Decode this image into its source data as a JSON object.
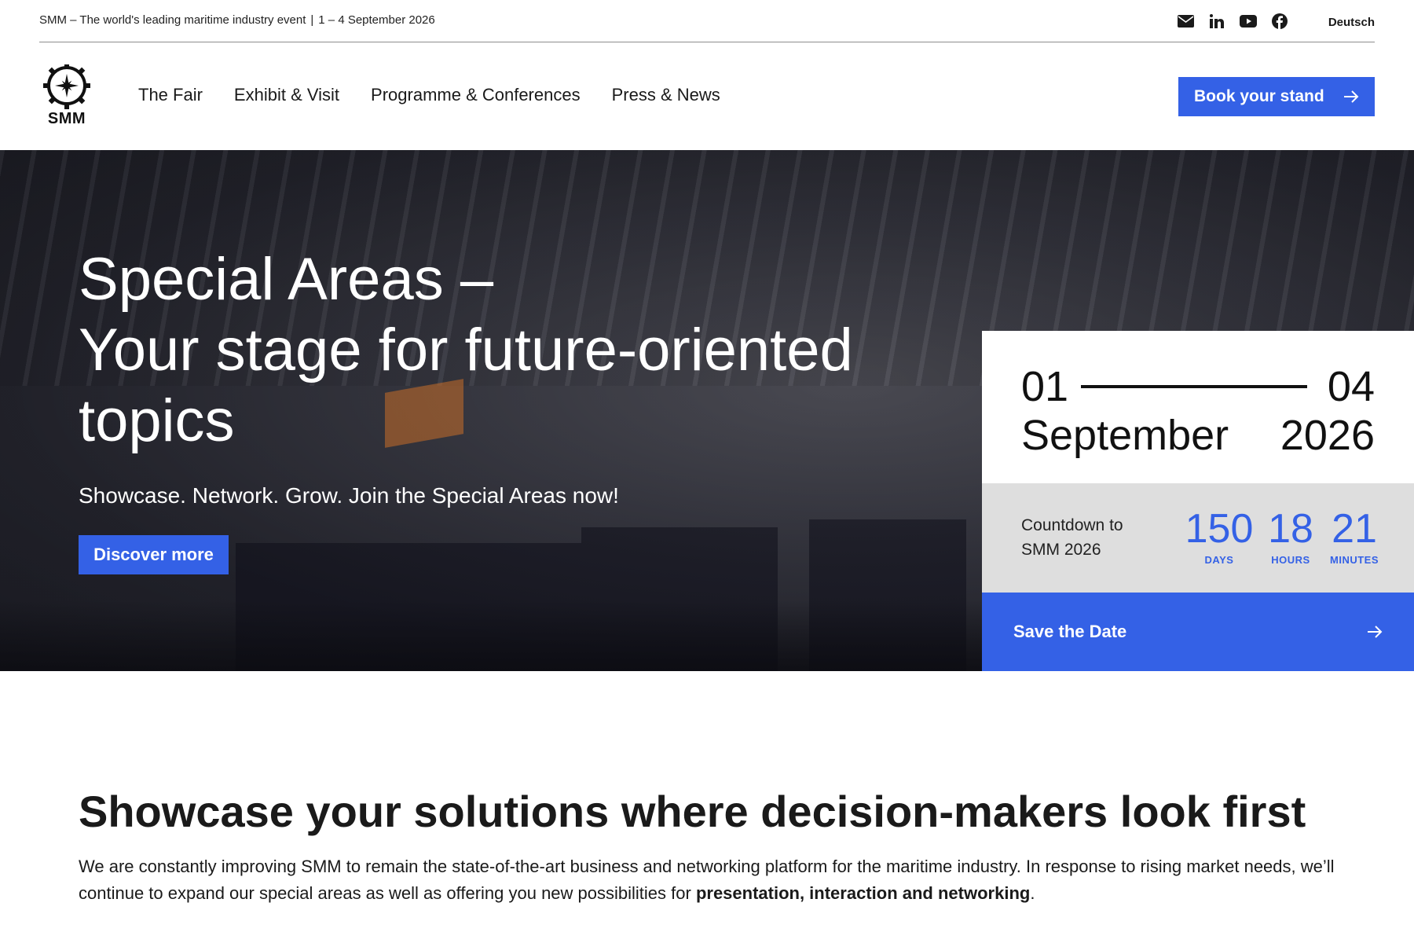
{
  "topbar": {
    "tagline_main": "SMM – The world's leading maritime industry event",
    "tagline_sep": "|",
    "tagline_dates": "1 – 4 September 2026",
    "language": "Deutsch",
    "socials": [
      "mail-icon",
      "linkedin-icon",
      "youtube-icon",
      "facebook-icon"
    ]
  },
  "header": {
    "logo_text": "SMM",
    "nav": [
      "The Fair",
      "Exhibit & Visit",
      "Programme & Conferences",
      "Press & News"
    ],
    "cta_label": "Book your stand",
    "cta_icon": "arrow-right-icon"
  },
  "hero": {
    "title_line1": "Special Areas –",
    "title_line2": "Your stage for future-oriented",
    "title_line3": "topics",
    "subtitle": "Showcase. Network. Grow. Join the Special Areas now!",
    "button_label": "Discover more"
  },
  "event_date": {
    "start_day": "01",
    "end_day": "04",
    "month": "September",
    "year": "2026",
    "countdown_label": "Countdown to SMM 2026",
    "days": "150",
    "days_label": "DAYS",
    "hours": "18",
    "hours_label": "HOURS",
    "minutes": "21",
    "minutes_label": "MINUTES",
    "save_label": "Save the Date"
  },
  "section": {
    "title": "Showcase your solutions where decision-makers look first",
    "body_plain": "We are constantly improving SMM to remain the state-of-the-art business and networking platform for the maritime industry. In response to rising market needs, we’ll continue to expand our special areas as well as offering you new possibilities for ",
    "body_bold": "presentation, interaction and networking",
    "body_end": "."
  },
  "colors": {
    "accent": "#3461e6",
    "card_grey": "#dedede"
  }
}
